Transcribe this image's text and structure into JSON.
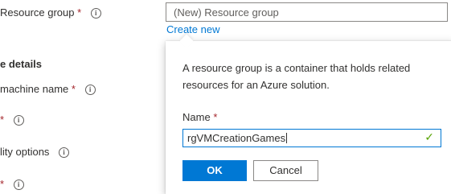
{
  "form": {
    "resource_group_label": "Resource group",
    "required_marker": "*",
    "section_heading": "e details",
    "vm_name_label": "machine name",
    "availability_label": "lity options"
  },
  "resource_group": {
    "placeholder": "(New) Resource group",
    "create_new_link": "Create new"
  },
  "callout": {
    "description": "A resource group is a container that holds related resources for an Azure solution.",
    "name_label": "Name",
    "name_value": "rgVMCreationGames",
    "ok_label": "OK",
    "cancel_label": "Cancel"
  },
  "icons": {
    "info": "info-icon",
    "valid": "checkmark-icon"
  },
  "colors": {
    "accent": "#0078d4",
    "required": "#a4262c",
    "valid": "#57a300"
  }
}
